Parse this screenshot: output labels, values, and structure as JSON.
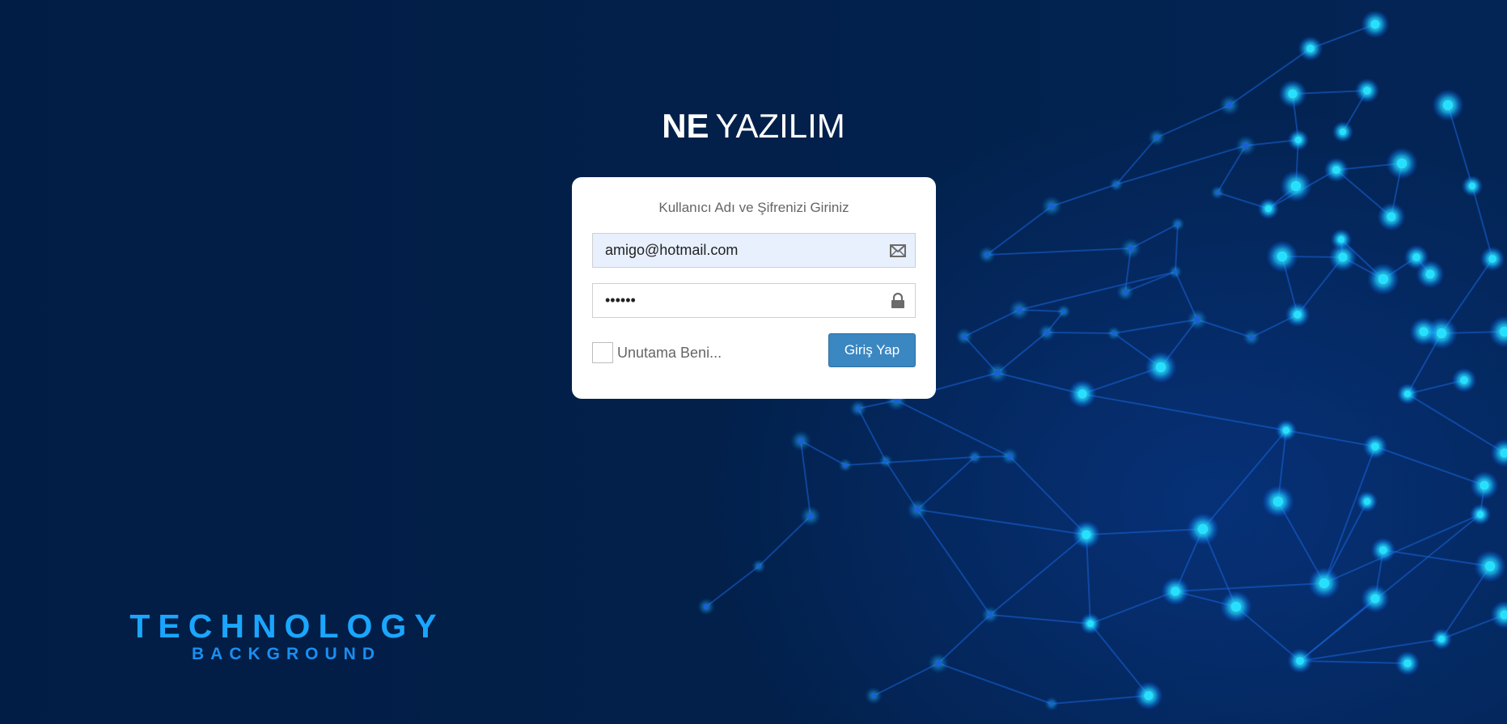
{
  "brand": {
    "bold": "NE",
    "light": "YAZILIM"
  },
  "login": {
    "title": "Kullanıcı Adı ve Şifrenizi Giriniz",
    "email_value": "amigo@hotmail.com",
    "password_value": "••••••",
    "email_icon": "envelope-icon",
    "password_icon": "lock-icon",
    "remember_label": "Unutama Beni...",
    "remember_checked": false,
    "submit_label": "Giriş Yap"
  },
  "background_logo": {
    "line1": "TECHNOLOGY",
    "line2": "BACKGROUND"
  },
  "colors": {
    "background": "#02204a",
    "card": "#ffffff",
    "button": "#3a87c2",
    "filled_input": "#e8f0fe",
    "logo_accent": "#1aa6ff",
    "network_node": "#19d2ff"
  }
}
